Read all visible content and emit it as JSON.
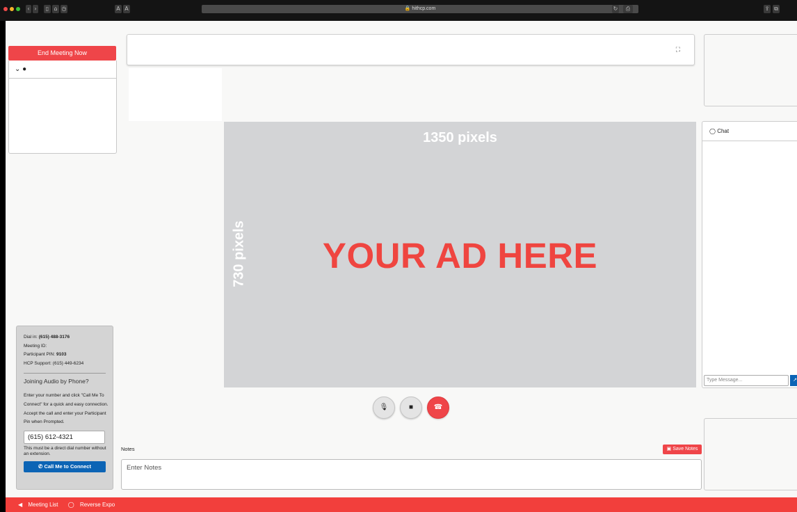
{
  "browser": {
    "url": "hithcp.com",
    "text_size_buttons": [
      "A",
      "A"
    ],
    "colors": {
      "close": "#ef4a4a",
      "minimize": "#f5b32a",
      "maximize": "#3cc23a"
    }
  },
  "meeting": {
    "end_label": "End Meeting Now",
    "participants_toggle_icon": "chevron-down-icon",
    "participant_icon": "user-icon"
  },
  "dialin": {
    "dial_in_label": "Dial in:",
    "dial_in_number": "(615) 488-3176",
    "meeting_id_label": "Meeting ID:",
    "pin_label": "Participant PIN:",
    "pin_value": "9103",
    "support_label": "HCP Support:",
    "support_number": "(615) 449-6234",
    "heading": "Joining Audio by Phone?",
    "description": "Enter your number and click \"Call Me To Connect\" for a quick and easy connection. Accept the call and enter your Participant Pin when Prompted.",
    "phone_value": "(615) 612-4321",
    "note": "This must be a direct dial number without an extension.",
    "call_button": "Call Me to Connect"
  },
  "ad": {
    "width_label": "1350 pixels",
    "height_label": "730 pixels",
    "main_text": "YOUR AD HERE",
    "background": "#d3d4d6",
    "text_color": "#ef4540"
  },
  "controls": {
    "mic_icon": "microphone-icon",
    "camera_icon": "video-camera-icon",
    "hangup_icon": "hang-up-icon"
  },
  "notes": {
    "label": "Notes",
    "save_label": "Save Notes",
    "placeholder": "Enter Notes"
  },
  "chat": {
    "title": "Chat",
    "placeholder": "Type Message..."
  },
  "footer": {
    "meeting_list": "Meeting List",
    "reverse_expo": "Reverse Expo"
  },
  "theme": {
    "accent_red": "#ef4549",
    "button_blue": "#0c64b5"
  }
}
